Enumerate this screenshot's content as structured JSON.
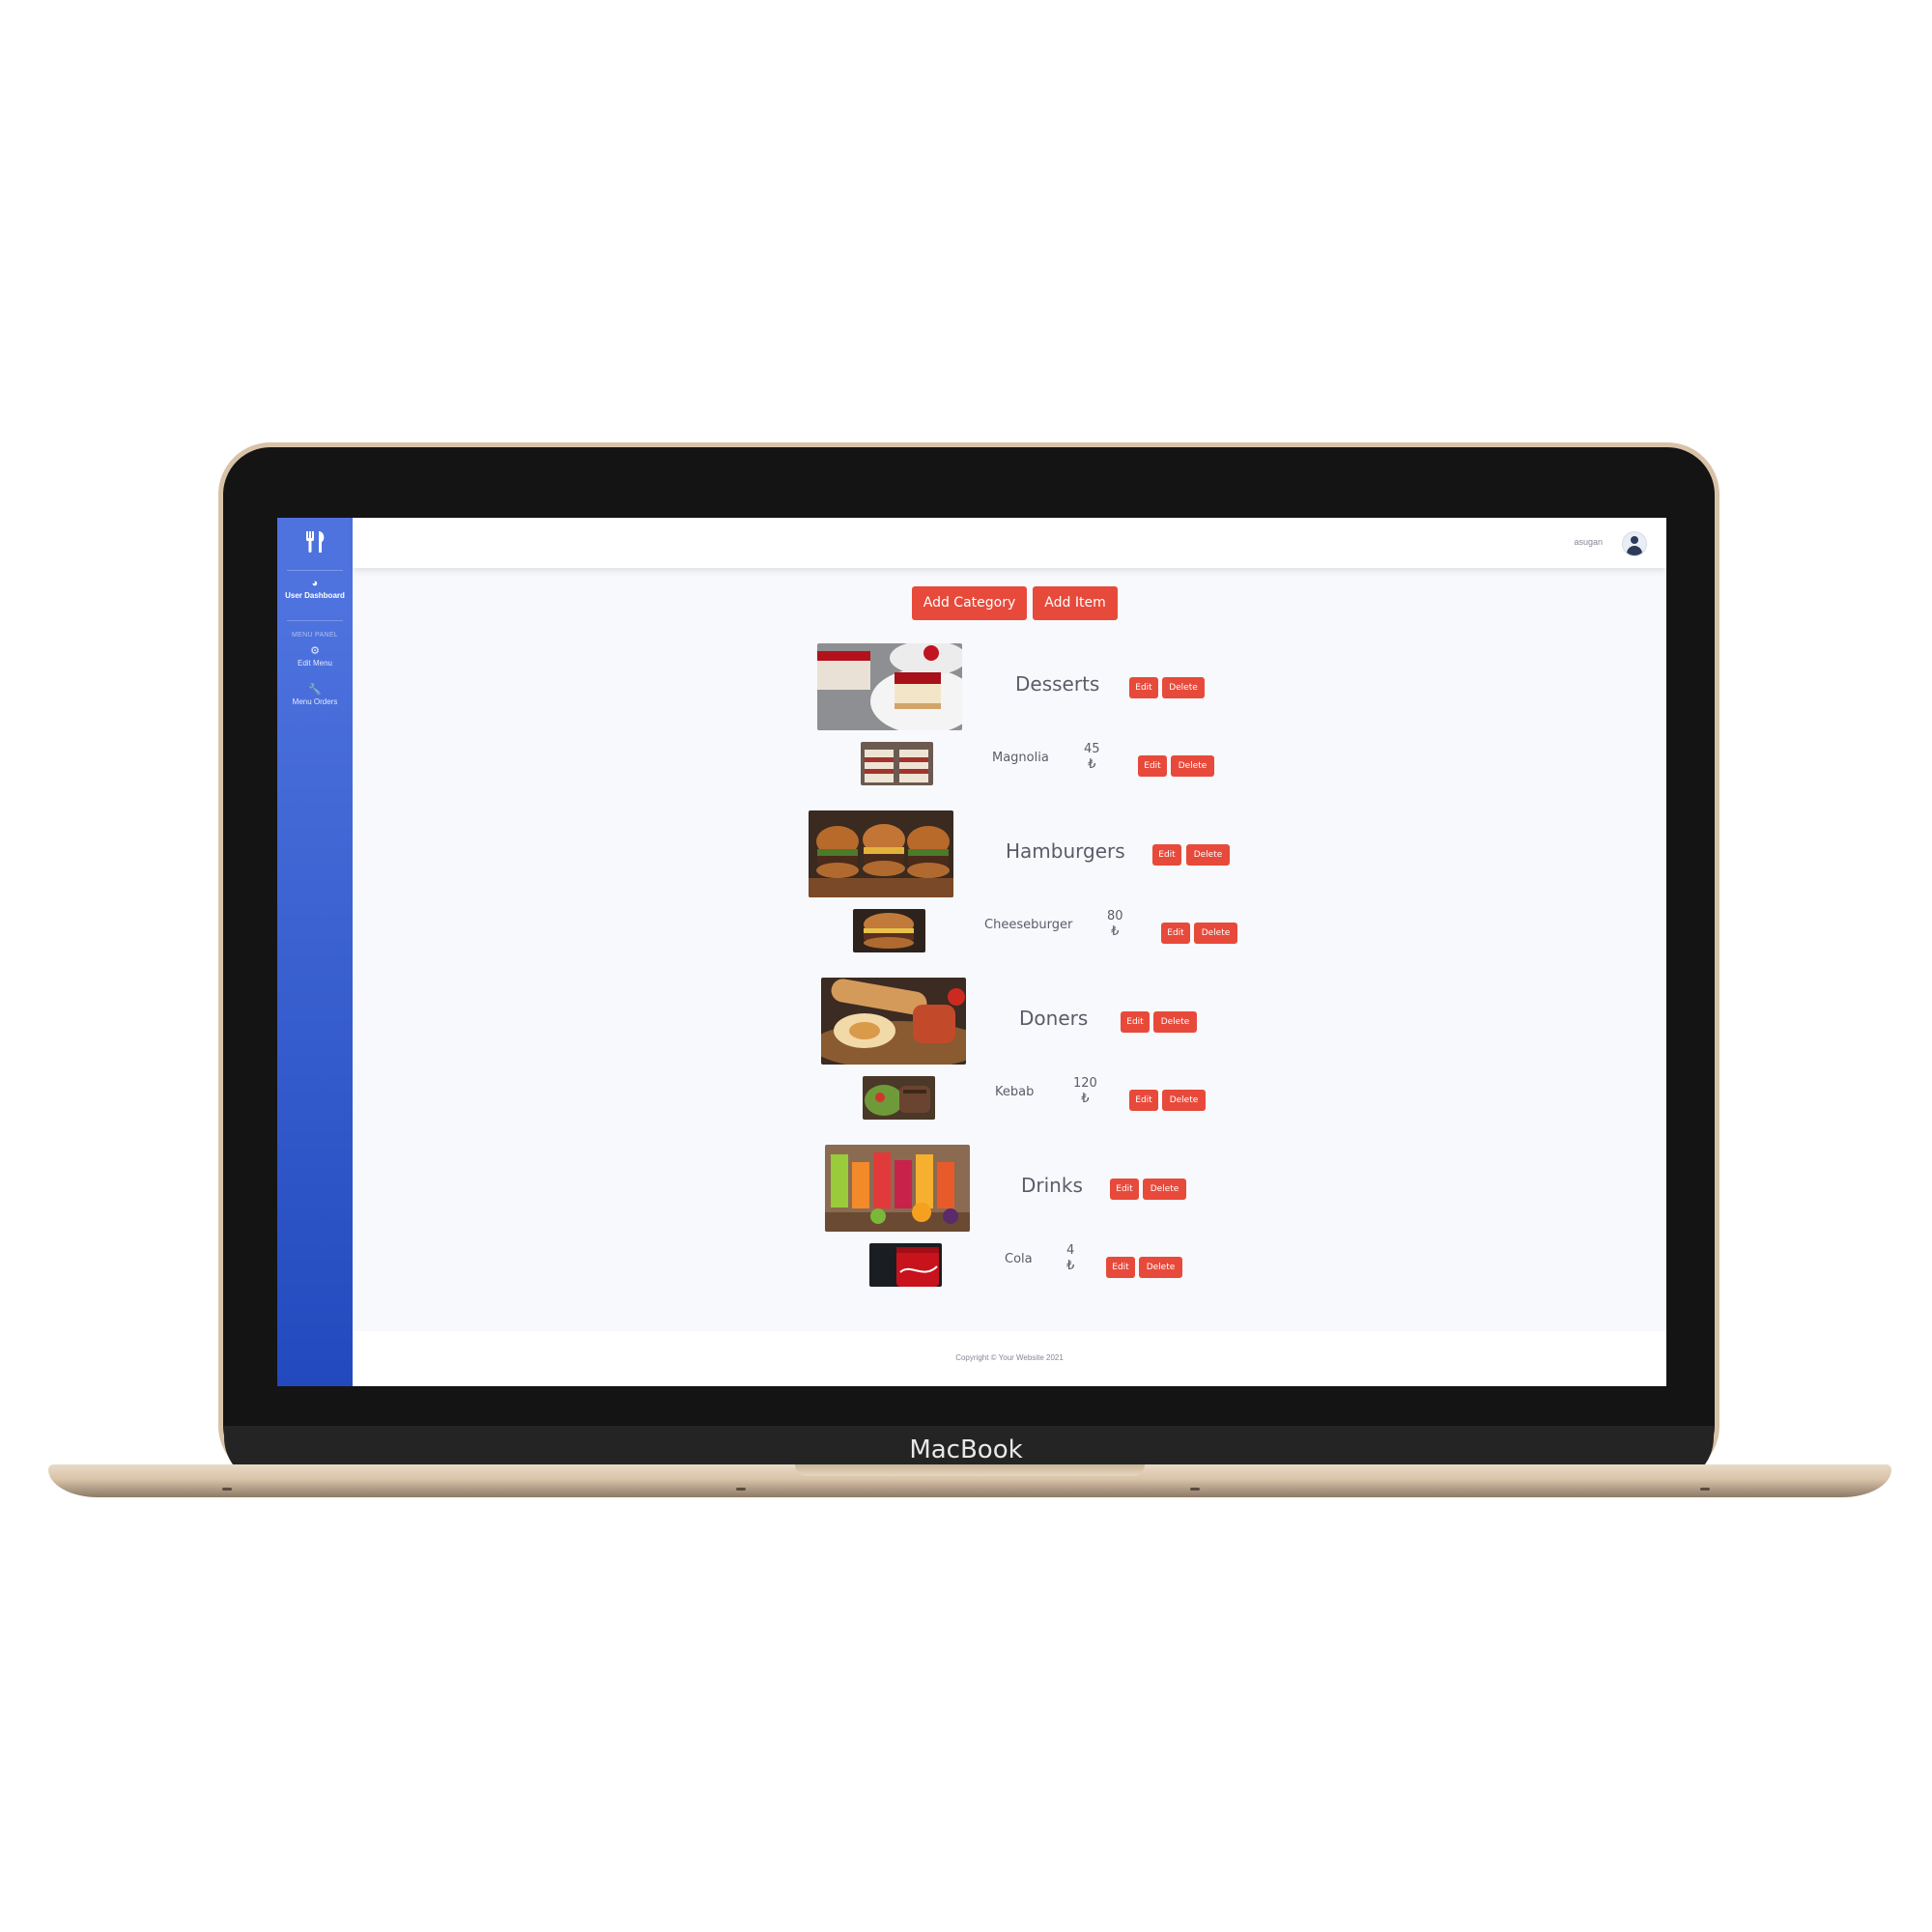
{
  "device": {
    "label": "MacBook"
  },
  "sidebar": {
    "items": [
      {
        "label": "User Dashboard"
      },
      {
        "label": "Edit Menu"
      },
      {
        "label": "Menu Orders"
      }
    ],
    "heading": "MENU PANEL"
  },
  "topbar": {
    "username": "asugan"
  },
  "actions": {
    "add_category": "Add Category",
    "add_item": "Add Item"
  },
  "row_buttons": {
    "edit": "Edit",
    "delete": "Delete"
  },
  "categories": [
    {
      "name": "Desserts",
      "item": {
        "name": "Magnolia",
        "price": "45",
        "currency": "₺"
      }
    },
    {
      "name": "Hamburgers",
      "item": {
        "name": "Cheeseburger",
        "price": "80",
        "currency": "₺"
      }
    },
    {
      "name": "Doners",
      "item": {
        "name": "Kebab",
        "price": "120",
        "currency": "₺"
      }
    },
    {
      "name": "Drinks",
      "item": {
        "name": "Cola",
        "price": "4",
        "currency": "₺"
      }
    }
  ],
  "footer": {
    "copyright": "Copyright © Your Website 2021"
  },
  "colors": {
    "primary": "#4e73df",
    "danger": "#e74a3b",
    "frame": "#d8c2a8"
  }
}
